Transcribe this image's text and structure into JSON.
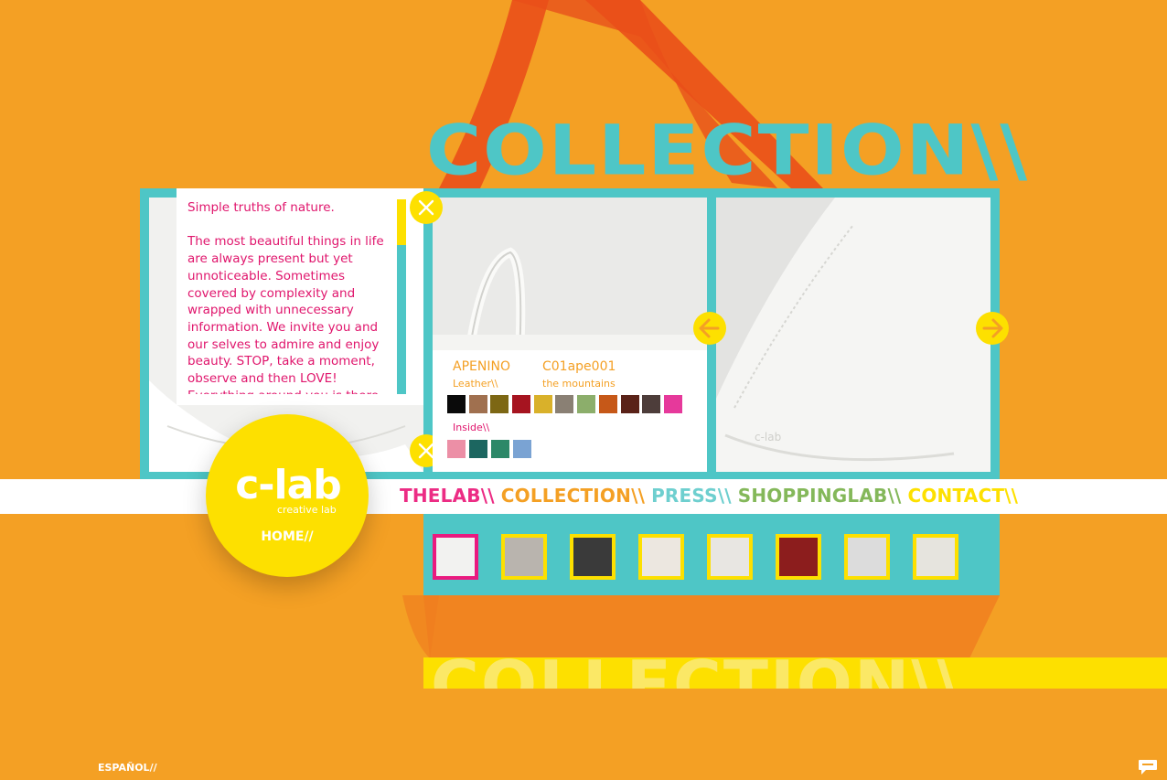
{
  "header": {
    "section_title": "COLLECTION\\\\"
  },
  "description": {
    "heading": "Simple truths of nature.",
    "body": "The most beautiful things in life are always present but yet unnoticeable. Sometimes covered by complexity and wrapped with unnecessary information. We invite you and our selves to admire and enjoy beauty. STOP, take a moment, observe and then LOVE! Everything around you is there."
  },
  "product": {
    "name": "APENINO",
    "code": "C01ape001",
    "material_label": "Leather\\\\",
    "subtitle": "the mountains",
    "inside_label": "Inside\\\\",
    "leather_colors": [
      "#0a0a0a",
      "#a0704f",
      "#7d6714",
      "#a61420",
      "#d9b12a",
      "#8a8074",
      "#8cae6b",
      "#c65818",
      "#5a2218",
      "#4d3d3a",
      "#e6399b"
    ],
    "inside_colors": [
      "#ec8fa6",
      "#1c6660",
      "#2c8868",
      "#7aa3d3"
    ]
  },
  "navigation": {
    "items": [
      {
        "label": "THELAB\\\\",
        "color": "#ec2c84"
      },
      {
        "label": "COLLECTION\\\\",
        "color": "#f4a024"
      },
      {
        "label": "PRESS\\\\",
        "color": "#6ecfcf"
      },
      {
        "label": "SHOPPINGLAB\\\\",
        "color": "#84b85a"
      },
      {
        "label": "CONTACT\\\\",
        "color": "#fde000"
      }
    ]
  },
  "logo": {
    "text": "c-lab",
    "tagline": "creative lab",
    "home_label": "HOME//"
  },
  "thumbnails": [
    {
      "color": "#f2f2f0",
      "selected": true
    },
    {
      "color": "#b9b4ae",
      "selected": false
    },
    {
      "color": "#3a3a3a",
      "selected": false
    },
    {
      "color": "#ece7e0",
      "selected": false
    },
    {
      "color": "#e8e6e2",
      "selected": false
    },
    {
      "color": "#8c1d1d",
      "selected": false
    },
    {
      "color": "#dcdcdc",
      "selected": false
    },
    {
      "color": "#e6e4de",
      "selected": false
    }
  ],
  "footer": {
    "language_link": "ESPAÑOL//",
    "chat_icon": "chat-icon"
  },
  "colors": {
    "background": "#f4a024",
    "teal": "#4ec6c6",
    "yellow": "#fde000",
    "pink": "#e0156c"
  }
}
